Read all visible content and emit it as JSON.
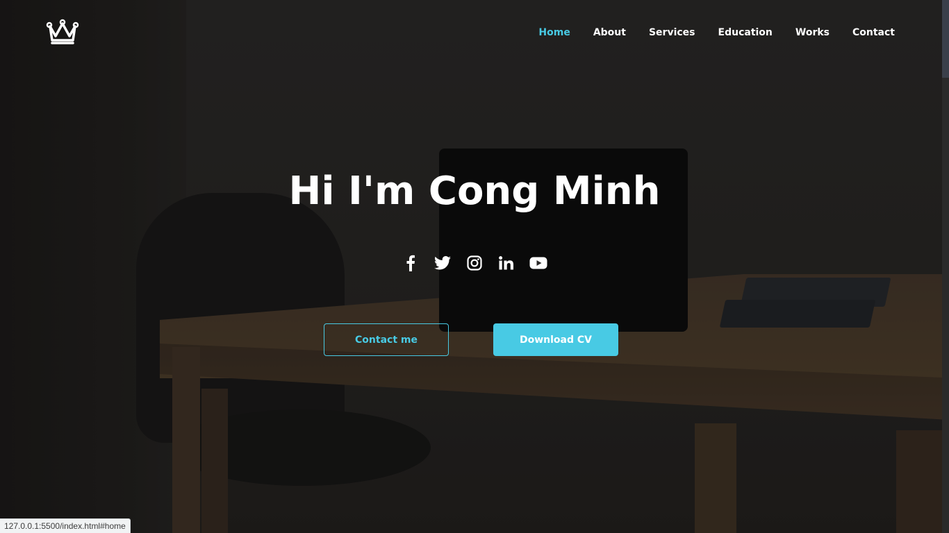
{
  "header": {
    "logo": "crown-icon",
    "nav": [
      {
        "label": "Home",
        "active": true
      },
      {
        "label": "About",
        "active": false
      },
      {
        "label": "Services",
        "active": false
      },
      {
        "label": "Education",
        "active": false
      },
      {
        "label": "Works",
        "active": false
      },
      {
        "label": "Contact",
        "active": false
      }
    ]
  },
  "hero": {
    "title": "Hi I'm Cong Minh",
    "socials": [
      "facebook-icon",
      "twitter-icon",
      "instagram-icon",
      "linkedin-icon",
      "youtube-icon"
    ],
    "buttons": {
      "contact_label": "Contact me",
      "download_label": "Download CV"
    }
  },
  "status_bar": {
    "url": "127.0.0.1:5500/index.html#home"
  },
  "colors": {
    "accent": "#48cae4",
    "text": "#ffffff"
  }
}
